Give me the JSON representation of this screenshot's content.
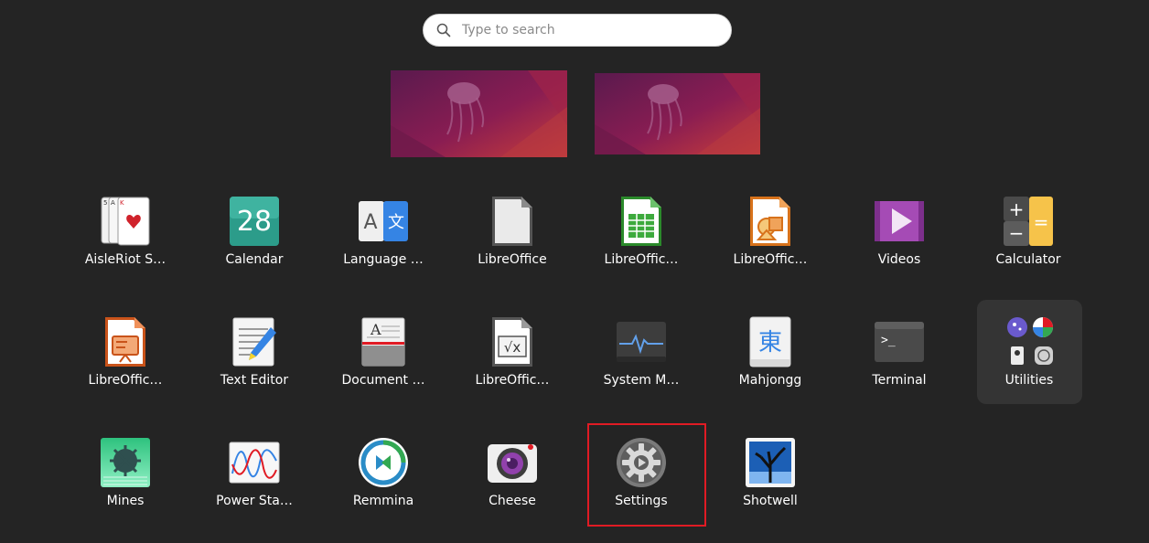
{
  "search": {
    "placeholder": "Type to search",
    "icon": "search-icon"
  },
  "workspaces": [
    {
      "name": "workspace-1"
    },
    {
      "name": "workspace-2"
    }
  ],
  "apps": {
    "row1": [
      {
        "label": "AisleRiot S…",
        "icon": "cards-icon"
      },
      {
        "label": "Calendar",
        "icon": "calendar-icon",
        "day": "28"
      },
      {
        "label": "Language …",
        "icon": "language-icon",
        "glyph_a": "A",
        "glyph_b": "文"
      },
      {
        "label": "LibreOffice",
        "icon": "libreoffice-icon"
      },
      {
        "label": "LibreOffic…",
        "icon": "libreoffice-calc-icon"
      },
      {
        "label": "LibreOffic…",
        "icon": "libreoffice-draw-icon"
      },
      {
        "label": "Videos",
        "icon": "videos-icon"
      },
      {
        "label": "Calculator",
        "icon": "calculator-icon"
      }
    ],
    "row2": [
      {
        "label": "LibreOffic…",
        "icon": "libreoffice-impress-icon"
      },
      {
        "label": "Text Editor",
        "icon": "text-editor-icon"
      },
      {
        "label": "Document …",
        "icon": "document-viewer-icon",
        "glyph": "A"
      },
      {
        "label": "LibreOffic…",
        "icon": "libreoffice-math-icon",
        "glyph": "√x"
      },
      {
        "label": "System M…",
        "icon": "system-monitor-icon"
      },
      {
        "label": "Mahjongg",
        "icon": "mahjongg-icon",
        "glyph": "東"
      },
      {
        "label": "Terminal",
        "icon": "terminal-icon",
        "glyph": ">_"
      },
      {
        "label": "Utilities",
        "icon": "utilities-folder-icon"
      }
    ],
    "row3": [
      {
        "label": "Mines",
        "icon": "mines-icon"
      },
      {
        "label": "Power Sta…",
        "icon": "power-statistics-icon"
      },
      {
        "label": "Remmina",
        "icon": "remmina-icon"
      },
      {
        "label": "Cheese",
        "icon": "cheese-icon"
      },
      {
        "label": "Settings",
        "icon": "settings-icon"
      },
      {
        "label": "Shotwell",
        "icon": "shotwell-icon"
      }
    ]
  },
  "colors": {
    "background": "#242424",
    "highlight": "#e01b24",
    "accent": "#e95420"
  }
}
